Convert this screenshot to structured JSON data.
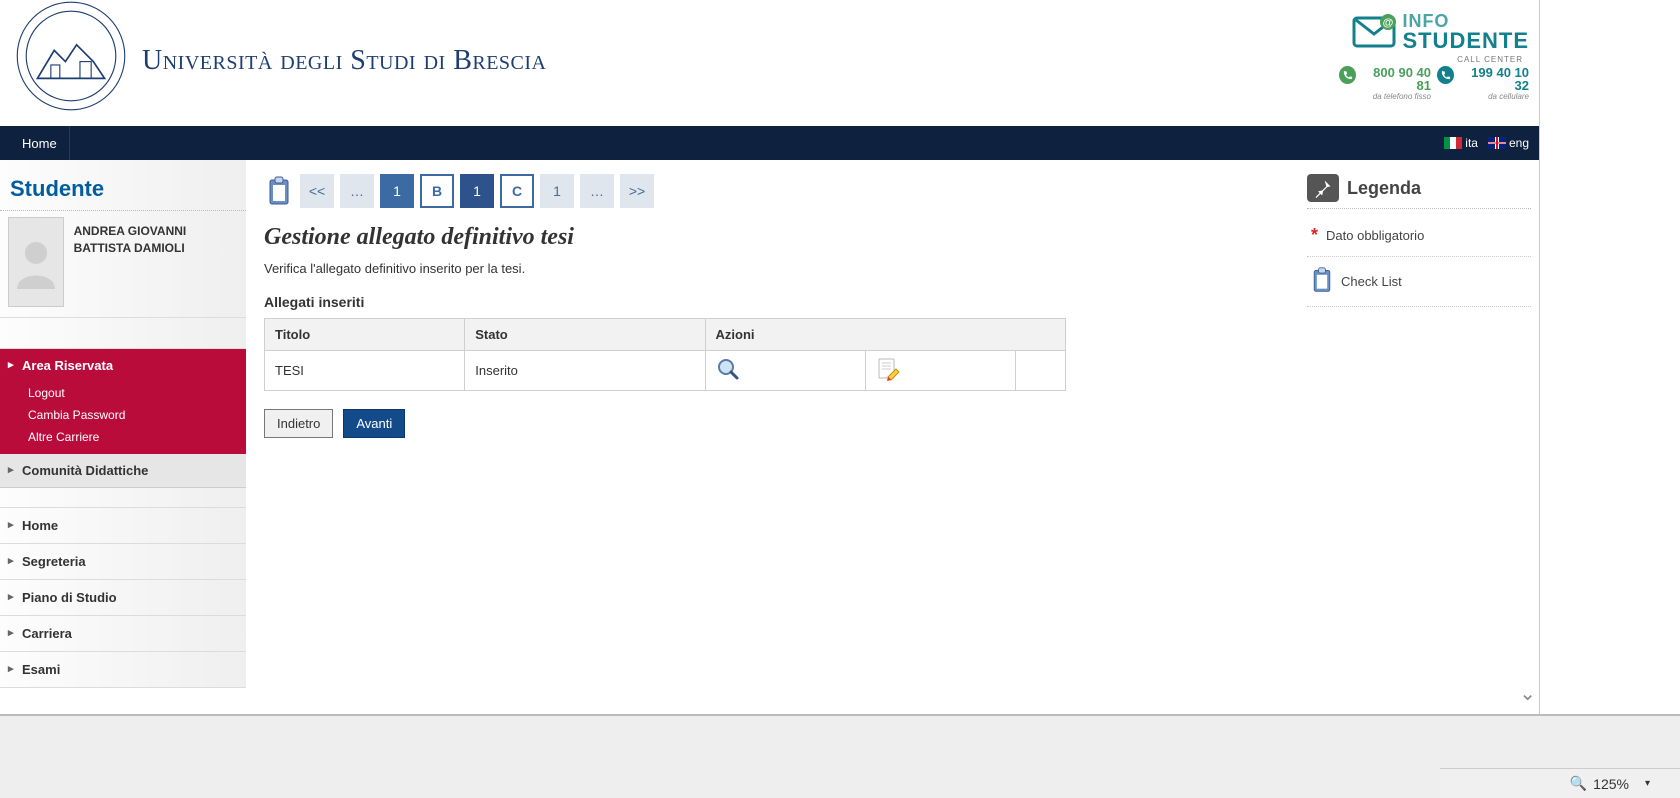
{
  "header": {
    "uni_name": "Università degli Studi di Brescia",
    "info_l1": "INFO",
    "info_l2": "STUDENTE",
    "callcenter": "CALL CENTER",
    "phone1": "800 90 40 81",
    "phone1_sub": "da telefono fisso",
    "phone2": "199 40 10 32",
    "phone2_sub": "da cellulare"
  },
  "navbar": {
    "home": "Home",
    "lang_ita": "ita",
    "lang_eng": "eng"
  },
  "sidebar": {
    "title": "Studente",
    "user_name": "ANDREA GIOVANNI BATTISTA DAMIOLI",
    "sections": {
      "area_riservata": "Area Riservata",
      "logout": "Logout",
      "cambia_password": "Cambia Password",
      "altre_carriere": "Altre Carriere",
      "comunita": "Comunità Didattiche"
    },
    "items": [
      "Home",
      "Segreteria",
      "Piano di Studio",
      "Carriera",
      "Esami"
    ]
  },
  "steps": {
    "first": "<<",
    "prev": "…",
    "s1": "1",
    "sB": "B",
    "s1b": "1",
    "sC": "C",
    "s1c": "1",
    "next": "…",
    "last": ">>"
  },
  "main": {
    "title": "Gestione allegato definitivo tesi",
    "sub": "Verifica l'allegato definitivo inserito per la tesi.",
    "sec": "Allegati inseriti",
    "th_titolo": "Titolo",
    "th_stato": "Stato",
    "th_azioni": "Azioni",
    "row_titolo": "TESI",
    "row_stato": "Inserito",
    "btn_back": "Indietro",
    "btn_next": "Avanti"
  },
  "legend": {
    "title": "Legenda",
    "mandatory": "Dato obbligatorio",
    "checklist": "Check List"
  },
  "zoom": {
    "value": "125%"
  }
}
